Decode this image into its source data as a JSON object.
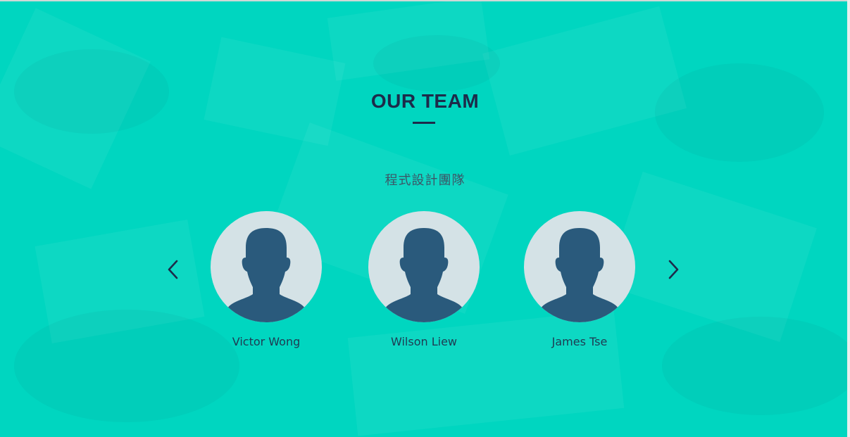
{
  "section": {
    "title": "OUR TEAM",
    "subtitle": "程式設計團隊"
  },
  "carousel": {
    "prev_icon": "chevron-left-icon",
    "next_icon": "chevron-right-icon"
  },
  "team": [
    {
      "name": "Victor Wong",
      "avatar_icon": "user-silhouette-icon"
    },
    {
      "name": "Wilson Liew",
      "avatar_icon": "user-silhouette-icon"
    },
    {
      "name": "James Tse",
      "avatar_icon": "user-silhouette-icon"
    }
  ],
  "colors": {
    "background": "#00d6c0",
    "heading": "#1d2b4a",
    "avatar_bg": "#d4e2e6",
    "silhouette": "#2a5a7c"
  }
}
